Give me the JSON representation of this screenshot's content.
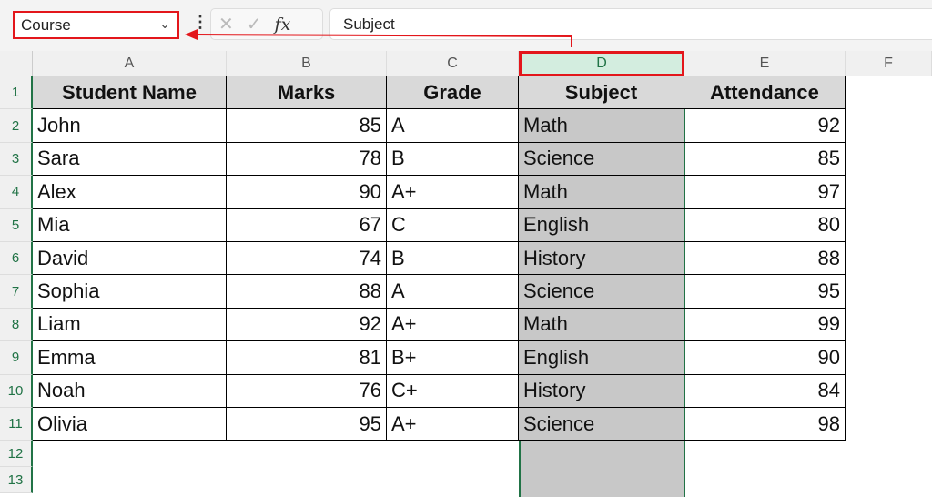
{
  "name_box": {
    "value": "Course"
  },
  "formula_bar": {
    "cancel": "✕",
    "enter": "✓",
    "fx": "fx",
    "value": "Subject"
  },
  "columns": [
    "A",
    "B",
    "C",
    "D",
    "E",
    "F"
  ],
  "rows": [
    "1",
    "2",
    "3",
    "4",
    "5",
    "6",
    "7",
    "8",
    "9",
    "10",
    "11",
    "12",
    "13"
  ],
  "headers": [
    "Student Name",
    "Marks",
    "Grade",
    "Subject",
    "Attendance"
  ],
  "data": [
    [
      "John",
      "85",
      "A",
      "Math",
      "92"
    ],
    [
      "Sara",
      "78",
      "B",
      "Science",
      "85"
    ],
    [
      "Alex",
      "90",
      "A+",
      "Math",
      "97"
    ],
    [
      "Mia",
      "67",
      "C",
      "English",
      "80"
    ],
    [
      "David",
      "74",
      "B",
      "History",
      "88"
    ],
    [
      "Sophia",
      "88",
      "A",
      "Science",
      "95"
    ],
    [
      "Liam",
      "92",
      "A+",
      "Math",
      "99"
    ],
    [
      "Emma",
      "81",
      "B+",
      "English",
      "90"
    ],
    [
      "Noah",
      "76",
      "C+",
      "History",
      "84"
    ],
    [
      "Olivia",
      "95",
      "A+",
      "Science",
      "98"
    ]
  ],
  "colors": {
    "highlight": "#e3161b",
    "selection": "#217346"
  }
}
